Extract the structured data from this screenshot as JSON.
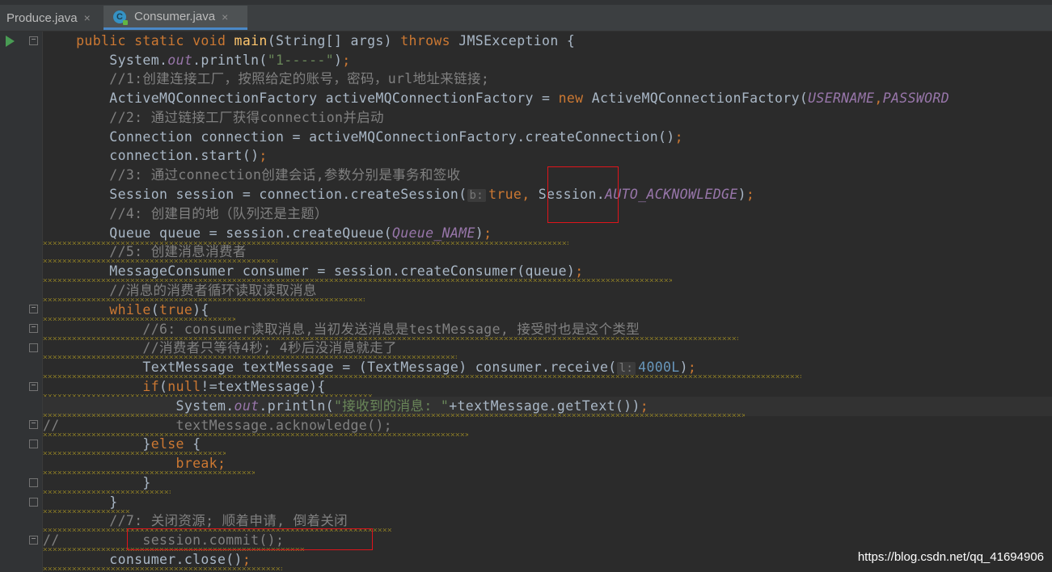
{
  "tabs": [
    {
      "label": "Produce.java",
      "close": "×",
      "active": false
    },
    {
      "label": "Consumer.java",
      "close": "×",
      "active": true
    }
  ],
  "code": {
    "l1": {
      "indent": "    ",
      "kw1": "public static void ",
      "fn": "main",
      "p1": "(String[] args) ",
      "kw2": "throws",
      "p2": " JMSException {"
    },
    "l2": {
      "indent": "        ",
      "a": "System.",
      "b": "out",
      "c": ".println(",
      "str": "\"1-----\"",
      "d": ")",
      "semi": ";"
    },
    "l3": {
      "indent": "        ",
      "cmt": "//1:创建连接工厂，按照给定的账号，密码，url地址来链接;"
    },
    "l4": {
      "indent": "        ",
      "a": "ActiveMQConnectionFactory activeMQConnectionFactory = ",
      "kw": "new",
      "b": " ActiveMQConnectionFactory(",
      "cst1": "USERNAME",
      "c": ",",
      "cst2": "PASSWORD"
    },
    "l5": {
      "indent": "        ",
      "cmt": "//2: 通过链接工厂获得connection并启动"
    },
    "l6": {
      "indent": "        ",
      "a": "Connection connection = activeMQConnectionFactory.createConnection()",
      "semi": ";"
    },
    "l7": {
      "indent": "        ",
      "a": "connection.start()",
      "semi": ";"
    },
    "l8": {
      "indent": "        ",
      "cmt": "//3: 通过connection创建会话,参数分别是事务和签收"
    },
    "l9": {
      "indent": "        ",
      "a": "Session session = connection.createSession(",
      "hint": "b:",
      "kw": "true,",
      "b": " Session.",
      "cst": "AUTO_ACKNOWLEDGE",
      "c": ")",
      "semi": ";"
    },
    "l10": {
      "indent": "        ",
      "cmt": "//4: 创建目的地（队列还是主题）"
    },
    "l11": {
      "indent": "        ",
      "a": "Queue queue = session.createQueue(",
      "cst": "Queue_NAME",
      "b": ")",
      "semi": ";"
    },
    "l12": {
      "indent": "        ",
      "cmt": "//5: 创建消息消费者"
    },
    "l13": {
      "indent": "        ",
      "a": "MessageConsumer consumer = session.createConsumer(queue)",
      "semi": ";"
    },
    "l14": {
      "indent": "        ",
      "cmt": "//消息的消费者循环读取读取消息"
    },
    "l15": {
      "indent": "        ",
      "kw1": "while",
      "a": "(",
      "kw2": "true",
      "b": "){"
    },
    "l16": {
      "indent": "            ",
      "cmt": "//6: consumer读取消息,当初发送消息是testMessage, 接受时也是这个类型"
    },
    "l17": {
      "indent": "            ",
      "cmt": "//消费者只等待4秒; 4秒后没消息就走了"
    },
    "l18": {
      "indent": "            ",
      "a": "TextMessage textMessage = (TextMessage) consumer.receive(",
      "hint": "l:",
      "num": "4000L",
      "b": ")",
      "semi": ";"
    },
    "l19": {
      "indent": "            ",
      "kw1": "if",
      "a": "(",
      "kw2": "null",
      "b": "!=textMessage){"
    },
    "l20": {
      "indent": "                ",
      "a": "System.",
      "b": "out",
      "c": ".println(",
      "str": "\"接收到的消息: \"",
      "d": "+textMessage.getText())",
      "semi": ";"
    },
    "l21": {
      "cmt": "//              textMessage.acknowledge();"
    },
    "l22": {
      "indent": "            ",
      "a": "}",
      "kw": "else",
      "b": " {"
    },
    "l23": {
      "indent": "                ",
      "kw": "break",
      "semi": ";"
    },
    "l24": {
      "indent": "            ",
      "a": "}"
    },
    "l25": {
      "indent": "        ",
      "a": "}"
    },
    "l26": {
      "indent": "        ",
      "cmt": "//7: 关闭资源; 顺着申请, 倒着关闭"
    },
    "l27": {
      "cmt": "//          session.commit();"
    },
    "l28": {
      "indent": "        ",
      "a": "consumer.close()",
      "semi": ";"
    }
  },
  "watermark": "https://blog.csdn.net/qq_41694906",
  "colors": {
    "keyword": "#cc7832",
    "function": "#ffc66d",
    "string": "#6a8759",
    "comment": "#808080",
    "constant": "#9876aa",
    "number": "#6897bb",
    "annotation_box": "#e0141b"
  }
}
